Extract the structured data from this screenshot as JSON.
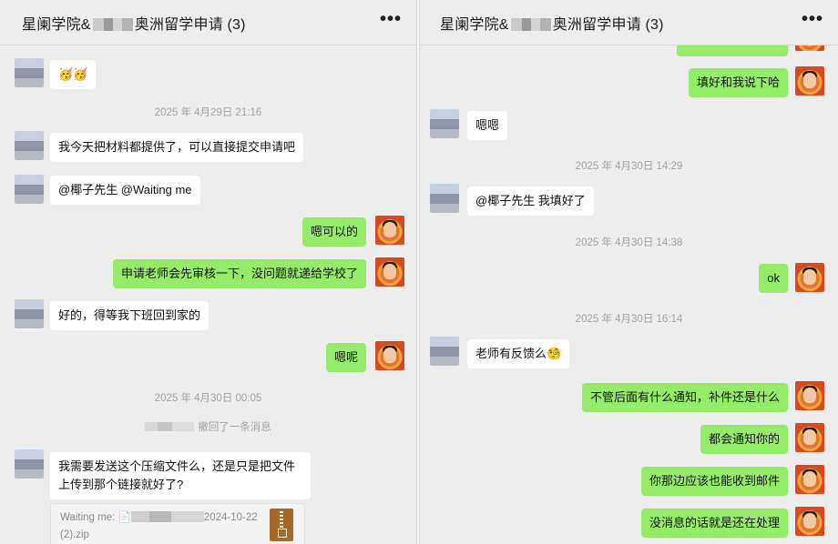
{
  "left_pane": {
    "title_prefix": "星阑学院&",
    "title_suffix": "奥洲留学申请 (3)",
    "menu_label": "•••",
    "messages": {
      "m1": "🥳🥳",
      "t1": "2025 年 4月29日 21:16",
      "m2": "我今天把材料都提供了，可以直接提交申请吧",
      "m3": "@椰子先生 @Waiting me",
      "m4": "嗯可以的",
      "m5": "申请老师会先审核一下，没问题就递给学校了",
      "m6": "好的，得等我下班回到家的",
      "m7": "嗯呢",
      "t2": "2025 年 4月30日 00:05",
      "recall": "撤回了一条消息",
      "m8": "我需要发送这个压缩文件么，还是只是把文件上传到那个链接就好了?",
      "quote_prefix": "Waiting me: 📄",
      "quote_suffix": "2024-10-22 (2).zip"
    }
  },
  "right_pane": {
    "title_prefix": "星阑学院&",
    "title_suffix": "奥洲留学申请 (3)",
    "menu_label": "•••",
    "messages": {
      "r1": "填好和我说下哈",
      "r2": "嗯嗯",
      "t1": "2025 年 4月30日 14:29",
      "r3": "@椰子先生 我填好了",
      "t2": "2025 年 4月30日 14:38",
      "r4": "ok",
      "t3": "2025 年 4月30日 16:14",
      "r5": "老师有反馈么🧐",
      "r6": "不管后面有什么通知，补件还是什么",
      "r7": "都会通知你的",
      "r8": "你那边应该也能收到邮件",
      "r9": "没消息的话就是还在处理"
    }
  },
  "colors": {
    "background": "#ededed",
    "incoming_bubble": "#ffffff",
    "outgoing_bubble": "#95ec69",
    "timestamp": "#a3a3a3"
  }
}
